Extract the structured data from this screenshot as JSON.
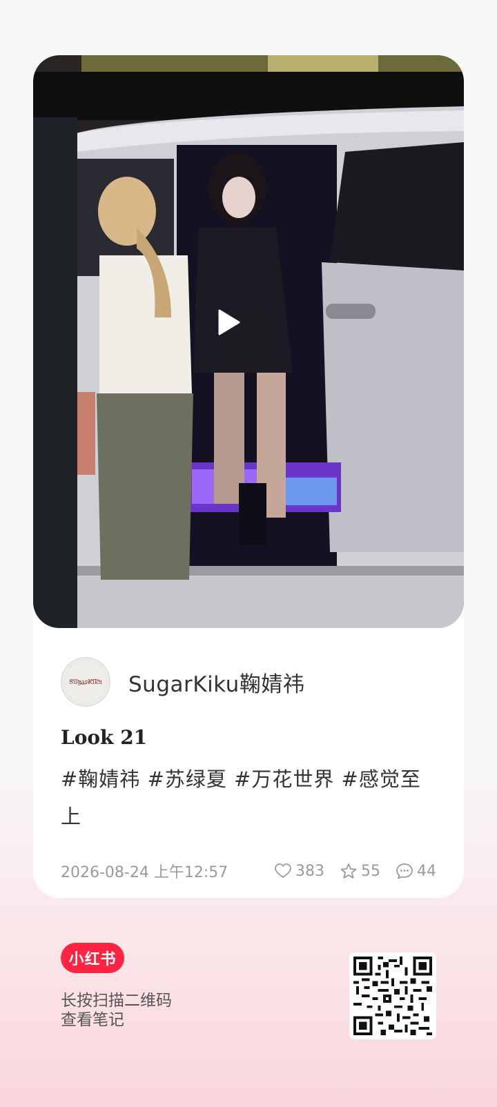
{
  "post": {
    "author_name": "SugarKiku鞠婧祎",
    "avatar_text": "SugarKiku",
    "title": "Look 21",
    "tags_text": "#鞠婧祎 #苏绿夏 #万花世界 #感觉至上",
    "date": "2026-08-24 上午12:57",
    "likes": "383",
    "favorites": "55",
    "comments": "44"
  },
  "footer": {
    "brand": "小红书",
    "scan_line1": "长按扫描二维码",
    "scan_line2": "查看笔记"
  },
  "icons": {
    "play": "play-icon",
    "like": "heart-icon",
    "favorite": "star-icon",
    "comment": "comment-icon",
    "qr": "qr-code"
  },
  "colors": {
    "brand": "#ff2442",
    "meta_text": "#9a9a9a"
  }
}
